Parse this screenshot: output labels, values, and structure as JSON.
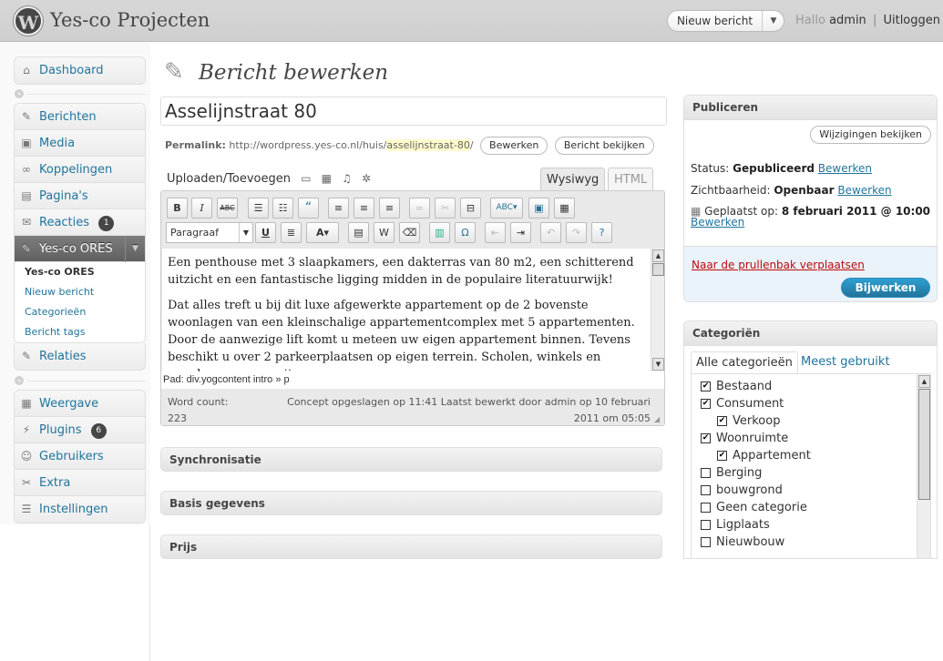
{
  "header": {
    "site_title": "Yes-co Projecten",
    "new_post": "Nieuw bericht",
    "greeting": "Hallo",
    "username": "admin",
    "logout": "Uitloggen"
  },
  "sidebar": {
    "dashboard": "Dashboard",
    "group1": [
      {
        "label": "Berichten",
        "icon": "pin-icon"
      },
      {
        "label": "Media",
        "icon": "media-icon"
      },
      {
        "label": "Koppelingen",
        "icon": "links-icon"
      },
      {
        "label": "Pagina's",
        "icon": "pages-icon"
      },
      {
        "label": "Reacties",
        "icon": "comments-icon",
        "badge": "1"
      },
      {
        "label": "Yes-co ORES",
        "icon": "pin-icon"
      }
    ],
    "submenu": [
      "Yes-co ORES",
      "Nieuw bericht",
      "Categorieën",
      "Bericht tags"
    ],
    "relaties": "Relaties",
    "group2": [
      {
        "label": "Weergave",
        "icon": "appearance-icon"
      },
      {
        "label": "Plugins",
        "icon": "plugins-icon",
        "badge": "6"
      },
      {
        "label": "Gebruikers",
        "icon": "users-icon"
      },
      {
        "label": "Extra",
        "icon": "tools-icon"
      },
      {
        "label": "Instellingen",
        "icon": "settings-icon"
      }
    ]
  },
  "main": {
    "page_title": "Bericht bewerken",
    "post_title": "Asselijnstraat 80",
    "permalink_label": "Permalink:",
    "permalink_base": "http://wordpress.yes-co.nl/huis/",
    "permalink_slug": "asselijnstraat-80",
    "permalink_end": "/",
    "edit_btn": "Bewerken",
    "view_btn": "Bericht bekijken",
    "upload_label": "Uploaden/Toevoegen",
    "tab_visual": "Wysiwyg",
    "tab_html": "HTML",
    "format_select": "Paragraaf",
    "paragraph1": "Een penthouse met 3 slaapkamers, een dakterras van 80 m2, een schitterend uitzicht en een fantastische ligging midden in de populaire literatuurwijk!",
    "paragraph2": "Dat alles treft u bij dit luxe afgewerkte appartement op de 2 bovenste woonlagen van een kleinschalige appartementcomplex met 5 appartementen. Door de aanwezige lift komt u meteen uw eigen appartement binnen. Tevens beschikt u over 2 parkeerplaatsen op eigen terrein. Scholen, winkels en openbaar vervoer zijn op een",
    "path": "Pad: div.yogcontent intro » p",
    "word_count_label": "Word count:",
    "word_count": "223",
    "autosave_line1": "Concept opgeslagen op 11:41 Laatst bewerkt door admin op 10 februari",
    "autosave_line2": "2011 om 05:05",
    "boxes": [
      "Synchronisatie",
      "Basis gegevens",
      "Prijs"
    ]
  },
  "publish": {
    "title": "Publiceren",
    "preview": "Wijzigingen bekijken",
    "status_label": "Status:",
    "status": "Gepubliceerd",
    "visibility_label": "Zichtbaarheid:",
    "visibility": "Openbaar",
    "edit": "Bewerken",
    "published_label": "Geplaatst op:",
    "published_date": "8 februari 2011 @ 10:00",
    "trash": "Naar de prullenbak verplaatsen",
    "update": "Bijwerken"
  },
  "categories": {
    "title": "Categoriën",
    "tab_all": "Alle categorieën",
    "tab_popular": "Meest gebruikt",
    "items": [
      {
        "label": "Bestaand",
        "checked": true,
        "indent": 0
      },
      {
        "label": "Consument",
        "checked": true,
        "indent": 0
      },
      {
        "label": "Verkoop",
        "checked": true,
        "indent": 1
      },
      {
        "label": "Woonruimte",
        "checked": true,
        "indent": 0
      },
      {
        "label": "Appartement",
        "checked": true,
        "indent": 1
      },
      {
        "label": "Berging",
        "checked": false,
        "indent": 0
      },
      {
        "label": "bouwgrond",
        "checked": false,
        "indent": 0
      },
      {
        "label": "Geen categorie",
        "checked": false,
        "indent": 0
      },
      {
        "label": "Ligplaats",
        "checked": false,
        "indent": 0
      },
      {
        "label": "Nieuwbouw",
        "checked": false,
        "indent": 0
      }
    ]
  },
  "colors": {
    "link": "#21759b",
    "primary_button": "#21759b",
    "trash": "#bc0b0b",
    "current_menu": "#6d6d6d"
  }
}
